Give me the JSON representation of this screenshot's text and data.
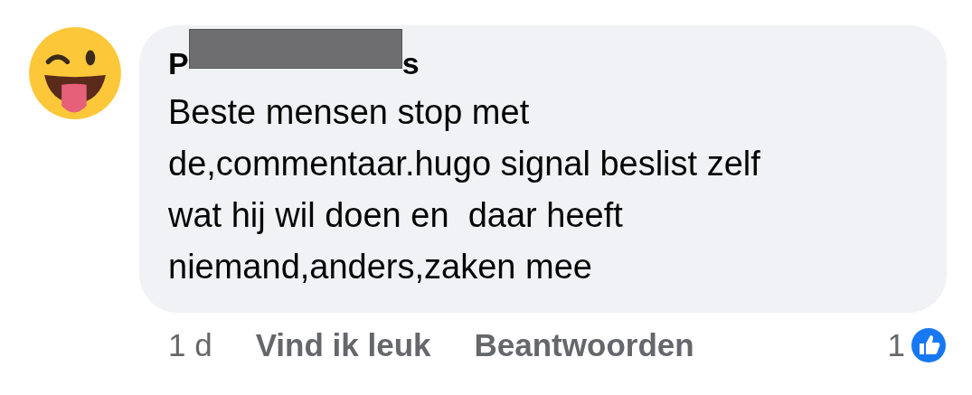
{
  "comment": {
    "author_start": "P",
    "author_end": "s",
    "author_redacted": true,
    "text": "Beste mensen stop met\nde,commentaar.hugo signal beslist zelf\nwat hij wil doen en  daar heeft\nniemand,anders,zaken mee"
  },
  "footer": {
    "time": "1 d",
    "actions": [
      "Vind ik leuk",
      "Beantwoorden"
    ],
    "reaction_count": "1"
  }
}
